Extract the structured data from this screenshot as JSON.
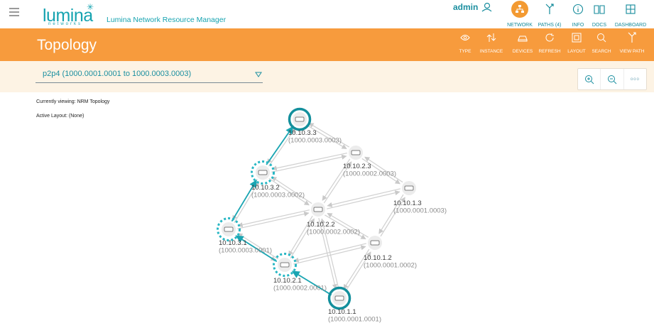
{
  "header": {
    "logo_text": "lumina",
    "logo_sub": "networks",
    "app_title": "Lumina Network Resource Manager",
    "user": "admin",
    "nav": [
      {
        "label": "NETWORK",
        "icon": "network-icon",
        "active": true
      },
      {
        "label": "PATHS (4)",
        "icon": "paths-icon",
        "active": false
      },
      {
        "label": "INFO",
        "icon": "info-icon",
        "active": false
      },
      {
        "label": "DOCS",
        "icon": "docs-icon",
        "active": false
      },
      {
        "label": "DASHBOARD",
        "icon": "dashboard-icon",
        "active": false
      }
    ]
  },
  "page": {
    "title": "Topology",
    "tools": [
      {
        "label": "TYPE",
        "icon": "eye-icon"
      },
      {
        "label": "INSTANCE",
        "icon": "instance-icon"
      },
      {
        "label": "DEVICES",
        "icon": "devices-icon"
      },
      {
        "label": "REFRESH",
        "icon": "refresh-icon"
      },
      {
        "label": "LAYOUT",
        "icon": "layout-icon"
      },
      {
        "label": "SEARCH",
        "icon": "search-icon"
      },
      {
        "label": "VIEW PATH",
        "icon": "view-path-icon"
      }
    ]
  },
  "path_selector": {
    "value": "p2p4 (1000.0001.0001 to 1000.0003.0003)"
  },
  "zoom": {
    "zoom_in_icon": "zoom-in-icon",
    "zoom_out_icon": "zoom-out-icon",
    "more": "ooo"
  },
  "status": {
    "viewing": "Currently viewing: NRM Topology",
    "layout": "Active Layout: (None)"
  },
  "colors": {
    "accent": "#f79b3d",
    "teal": "#16a3b0",
    "subbar": "#fdf3e4"
  },
  "nodes": [
    {
      "id": "10.10.3.3",
      "sub": "(1000.0003.0003)",
      "role": "endpoint"
    },
    {
      "id": "10.10.2.3",
      "sub": "(1000.0002.0003)",
      "role": "normal"
    },
    {
      "id": "10.10.3.2",
      "sub": "(1000.0003.0002)",
      "role": "path"
    },
    {
      "id": "10.10.1.3",
      "sub": "(1000.0001.0003)",
      "role": "normal"
    },
    {
      "id": "10.10.2.2",
      "sub": "(1000.0002.0002)",
      "role": "normal"
    },
    {
      "id": "10.10.3.1",
      "sub": "(1000.0003.0001)",
      "role": "path"
    },
    {
      "id": "10.10.1.2",
      "sub": "(1000.0001.0002)",
      "role": "normal"
    },
    {
      "id": "10.10.2.1",
      "sub": "(1000.0002.0001)",
      "role": "path"
    },
    {
      "id": "10.10.1.1",
      "sub": "(1000.0001.0001)",
      "role": "endpoint"
    }
  ]
}
